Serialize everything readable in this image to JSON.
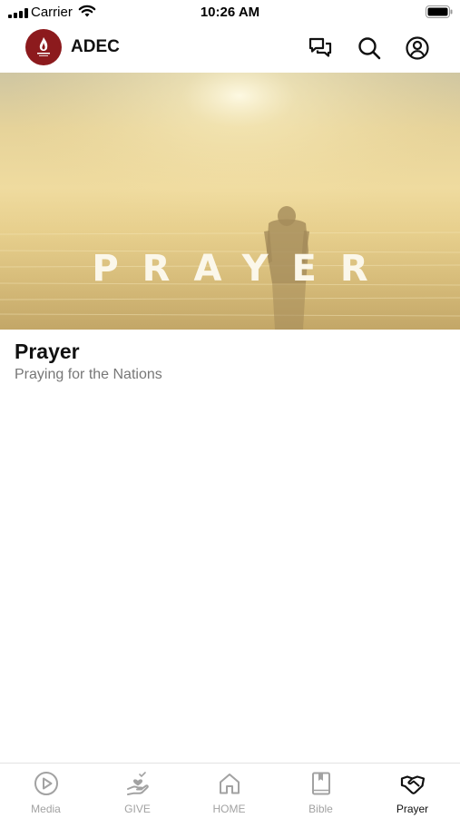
{
  "status_bar": {
    "carrier": "Carrier",
    "time": "10:26 AM"
  },
  "header": {
    "app_name": "ADEC",
    "icons": [
      "messages-icon",
      "search-icon",
      "account-icon"
    ]
  },
  "hero": {
    "title": "PRAYER"
  },
  "content": {
    "title": "Prayer",
    "subtitle": "Praying for the Nations"
  },
  "tab_bar": {
    "tabs": [
      {
        "label": "Media",
        "icon": "play-circle-icon",
        "active": false
      },
      {
        "label": "GIVE",
        "icon": "giving-hand-icon",
        "active": false
      },
      {
        "label": "HOME",
        "icon": "home-icon",
        "active": false
      },
      {
        "label": "Bible",
        "icon": "bible-icon",
        "active": false
      },
      {
        "label": "Prayer",
        "icon": "handshake-icon",
        "active": true
      }
    ]
  }
}
